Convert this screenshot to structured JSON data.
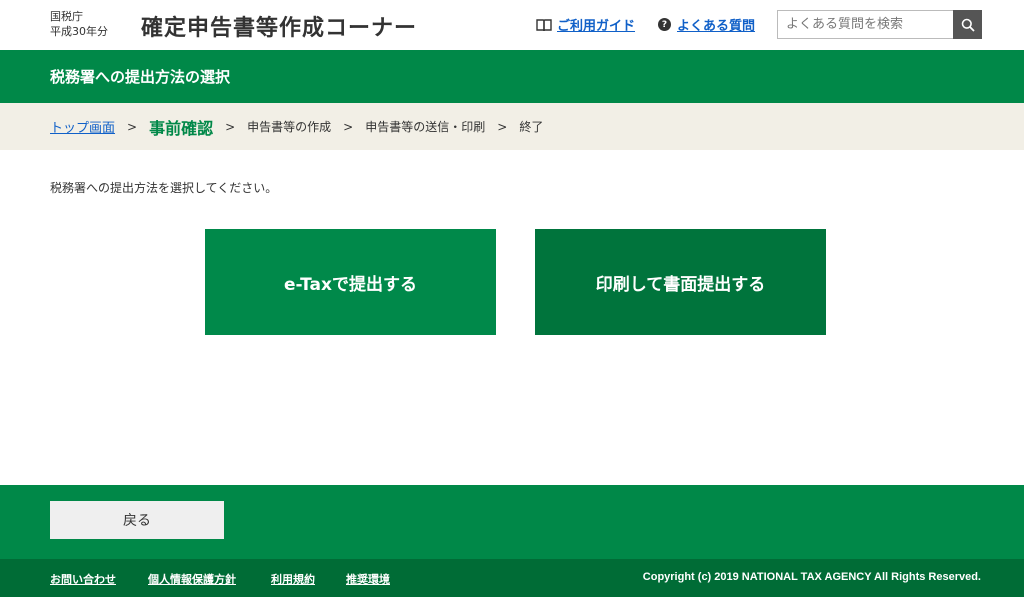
{
  "header": {
    "agency_line1": "国税庁",
    "agency_line2": "平成30年分",
    "site_title": "確定申告書等作成コーナー",
    "guide_link": "ご利用ガイド",
    "faq_link": "よくある質問",
    "search_placeholder": "よくある質問を検索",
    "icons": {
      "guide": "book-icon",
      "faq": "question-circle-icon",
      "search": "search-icon"
    }
  },
  "title_bar": {
    "title": "税務署への提出方法の選択"
  },
  "breadcrumb": {
    "top": "トップ画面",
    "current": "事前確認",
    "step3": "申告書等の作成",
    "step4": "申告書等の送信・印刷",
    "step5": "終了"
  },
  "main": {
    "instruction": "税務署への提出方法を選択してください。",
    "etax_button": "e-Taxで提出する",
    "print_button": "印刷して書面提出する"
  },
  "footer": {
    "back_button": "戻る",
    "links": [
      "お問い合わせ",
      "個人情報保護方針",
      "利用規約",
      "推奨環境"
    ],
    "copyright": "Copyright (c) 2019 NATIONAL TAX AGENCY All Rights Reserved."
  },
  "colors": {
    "brand_green": "#008848",
    "etax_button": "#00894a",
    "print_button": "#00743c",
    "footer_dark": "#006c36",
    "breadcrumb_bg": "#f2efe6",
    "link_blue": "#1060c8"
  }
}
